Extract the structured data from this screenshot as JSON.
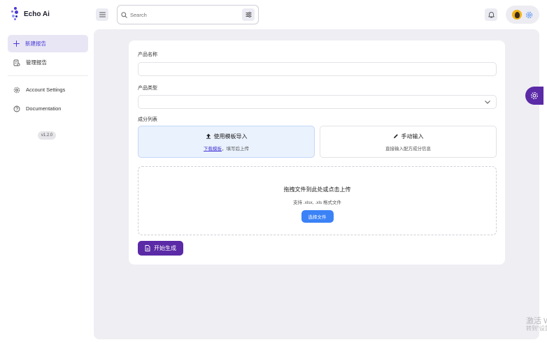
{
  "brand": {
    "name": "Echo Ai"
  },
  "search": {
    "placeholder": "Search"
  },
  "sidebar": {
    "items": [
      {
        "label": "新建报告",
        "icon": "plus-icon"
      },
      {
        "label": "管理报告",
        "icon": "report-manage-icon"
      },
      {
        "label": "Account Settings",
        "icon": "gear-icon"
      },
      {
        "label": "Documentation",
        "icon": "help-circle-icon"
      }
    ],
    "version": "v1.2.0"
  },
  "form": {
    "product_name_label": "产品名称",
    "product_type_label": "产品类型",
    "ingredients_label": "成分列表",
    "template_option": {
      "title": "使用模板导入",
      "link": "下载模板",
      "rest": "，填写后上传"
    },
    "manual_option": {
      "title": "手动输入",
      "subtitle": "直接输入配方成分信息"
    },
    "upload": {
      "title": "拖拽文件到此处或点击上传",
      "subtitle": "支持 .xlsx, .xls 格式文件",
      "button": "选择文件"
    },
    "start_button": "开始生成"
  },
  "watermark": {
    "line1": "激活 W",
    "line2": "转到\"设置"
  },
  "colors": {
    "accent": "#5b2aa6",
    "primary_blue": "#3b82f6",
    "highlight_bg": "#eaf2fd"
  }
}
